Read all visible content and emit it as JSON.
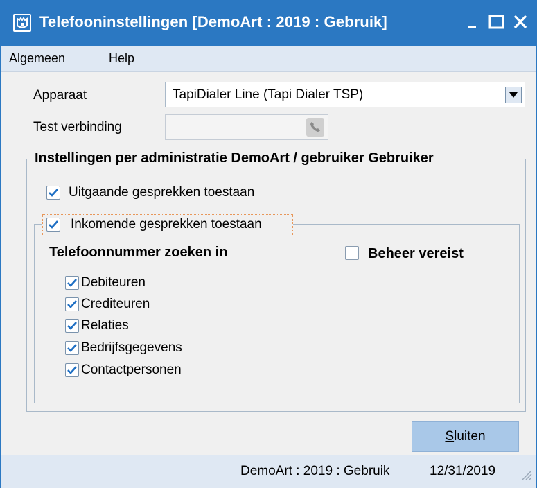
{
  "window": {
    "title": "Telefooninstellingen  [DemoArt : 2019 : Gebruik]",
    "icon": "castle-icon",
    "controls": [
      "minimize-icon",
      "maximize-icon",
      "close-icon"
    ]
  },
  "menu": {
    "items": [
      "Algemeen",
      "Help"
    ]
  },
  "form": {
    "apparaat_label": "Apparaat",
    "apparaat_value": "TapiDialer Line  (Tapi Dialer TSP)",
    "test_label": "Test verbinding",
    "test_value": ""
  },
  "settings": {
    "legend": "Instellingen per administratie DemoArt / gebruiker Gebruiker",
    "outgoing": {
      "label": "Uitgaande gesprekken toestaan",
      "checked": true
    },
    "incoming": {
      "label": "Inkomende gesprekken toestaan",
      "checked": true
    },
    "search_heading": "Telefoonnummer zoeken in",
    "beheer": {
      "label": "Beheer vereist",
      "checked": false
    },
    "search_items": [
      {
        "label": "Debiteuren",
        "checked": true
      },
      {
        "label": "Crediteuren",
        "checked": true
      },
      {
        "label": "Relaties",
        "checked": true
      },
      {
        "label": "Bedrijfsgegevens",
        "checked": true
      },
      {
        "label": "Contactpersonen",
        "checked": true
      }
    ]
  },
  "buttons": {
    "close_hotkey": "S",
    "close_rest": "luiten"
  },
  "status": {
    "administration": "DemoArt : 2019 : Gebruik",
    "date": "12/31/2019"
  },
  "colors": {
    "titlebar": "#2b78c2",
    "menubar": "#dfe8f3",
    "check": "#1e6fc4",
    "button": "#a9c8e8"
  }
}
